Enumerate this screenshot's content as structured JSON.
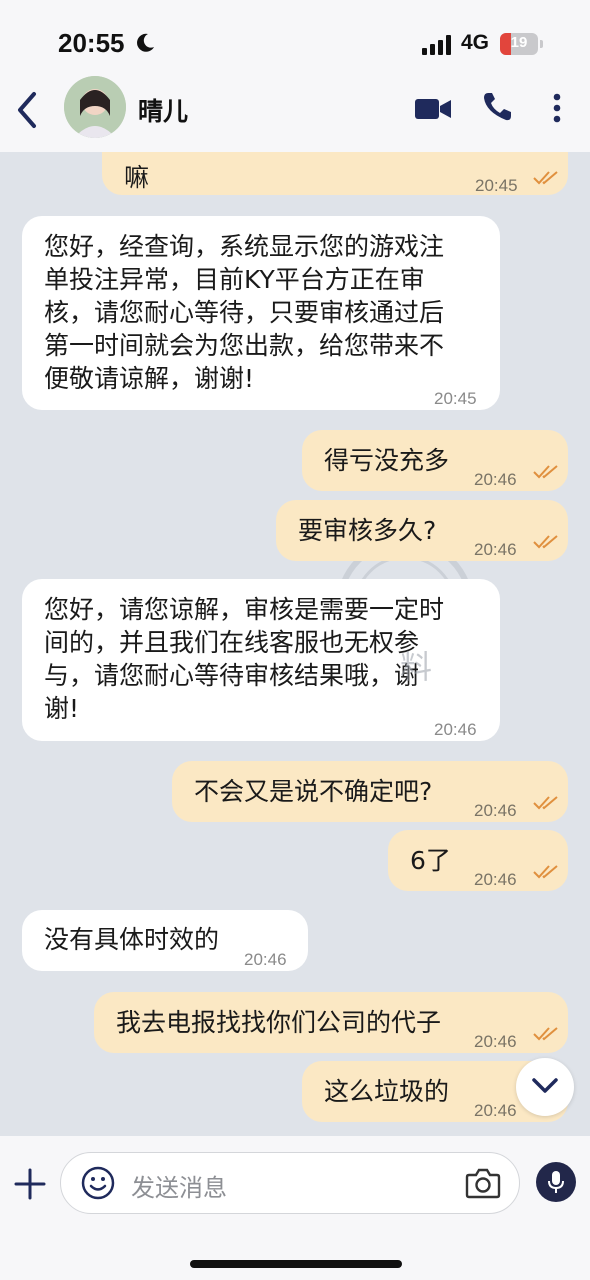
{
  "status_bar": {
    "time": "20:55",
    "network": "4G",
    "battery_level": "19"
  },
  "header": {
    "contact_name": "晴儿"
  },
  "messages": [
    {
      "dir": "out",
      "text": "嘛",
      "time": "20:45"
    },
    {
      "dir": "in",
      "text": "您好，经查询，系统显示您的游戏注\n单投注异常，目前KY平台方正在审\n核，请您耐心等待，只要审核通过后\n第一时间就会为您出款，给您带来不\n便敬请谅解，谢谢!",
      "time": "20:45"
    },
    {
      "dir": "out",
      "text": "得亏没充多",
      "time": "20:46"
    },
    {
      "dir": "out",
      "text": "要审核多久?",
      "time": "20:46"
    },
    {
      "dir": "in",
      "text": "您好，请您谅解，审核是需要一定时\n间的，并且我们在线客服也无权参\n与，请您耐心等待审核结果哦，谢\n谢!",
      "time": "20:46"
    },
    {
      "dir": "out",
      "text": "不会又是说不确定吧?",
      "time": "20:46"
    },
    {
      "dir": "out",
      "text": "6了",
      "time": "20:46"
    },
    {
      "dir": "in",
      "text": "没有具体时效的",
      "time": "20:46"
    },
    {
      "dir": "out",
      "text": "我去电报找找你们公司的代子",
      "time": "20:46"
    },
    {
      "dir": "out",
      "text": "这么垃圾的",
      "time": "20:46"
    }
  ],
  "watermark": {
    "text": "料"
  },
  "composer": {
    "placeholder": "发送消息"
  },
  "colors": {
    "outgoing_bubble": "#fbe8c4",
    "incoming_bubble": "#ffffff",
    "chat_background": "#dfe3e9",
    "accent": "#22274a"
  }
}
